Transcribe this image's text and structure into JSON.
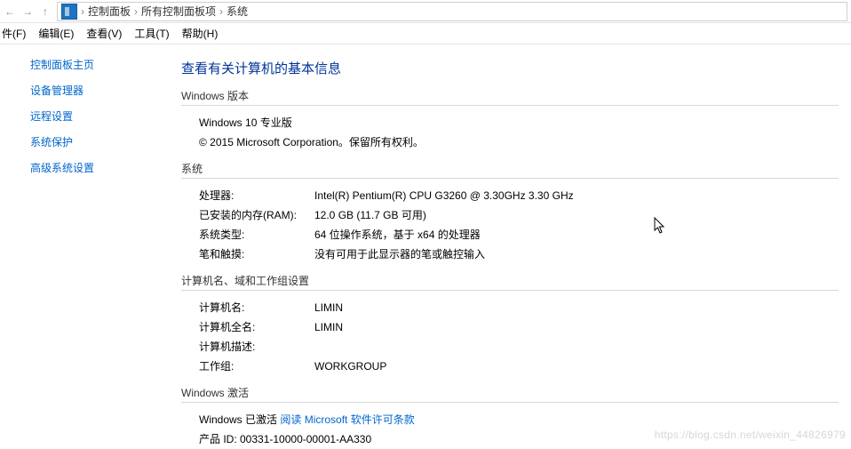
{
  "breadcrumb": {
    "items": [
      "控制面板",
      "所有控制面板项",
      "系统"
    ],
    "sep": "›"
  },
  "nav": {
    "back": "←",
    "fwd": "→",
    "up": "↑"
  },
  "menu": {
    "file": "件(F)",
    "edit": "编辑(E)",
    "view": "查看(V)",
    "tools": "工具(T)",
    "help": "帮助(H)"
  },
  "sidebar": {
    "home": "控制面板主页",
    "devmgr": "设备管理器",
    "remote": "远程设置",
    "protect": "系统保护",
    "advanced": "高级系统设置"
  },
  "page_title": "查看有关计算机的基本信息",
  "sections": {
    "win_edition": {
      "heading": "Windows 版本",
      "edition": "Windows 10 专业版",
      "copyright": "© 2015 Microsoft Corporation。保留所有权利。"
    },
    "system": {
      "heading": "系统",
      "rows": {
        "processor_lbl": "处理器:",
        "processor_val": "Intel(R) Pentium(R) CPU G3260 @ 3.30GHz   3.30 GHz",
        "ram_lbl": "已安装的内存(RAM):",
        "ram_val": "12.0 GB (11.7 GB 可用)",
        "type_lbl": "系统类型:",
        "type_val": "64 位操作系统，基于 x64 的处理器",
        "pen_lbl": "笔和触摸:",
        "pen_val": "没有可用于此显示器的笔或触控输入"
      }
    },
    "computer": {
      "heading": "计算机名、域和工作组设置",
      "rows": {
        "name_lbl": "计算机名:",
        "name_val": "LIMIN",
        "fullname_lbl": "计算机全名:",
        "fullname_val": "LIMIN",
        "desc_lbl": "计算机描述:",
        "desc_val": "",
        "workgroup_lbl": "工作组:",
        "workgroup_val": "WORKGROUP"
      }
    },
    "activation": {
      "heading": "Windows 激活",
      "status": "Windows 已激活  ",
      "link": "阅读 Microsoft 软件许可条款",
      "product_id": "产品 ID: 00331-10000-00001-AA330"
    }
  },
  "watermark": "https://blog.csdn.net/weixin_44826979"
}
